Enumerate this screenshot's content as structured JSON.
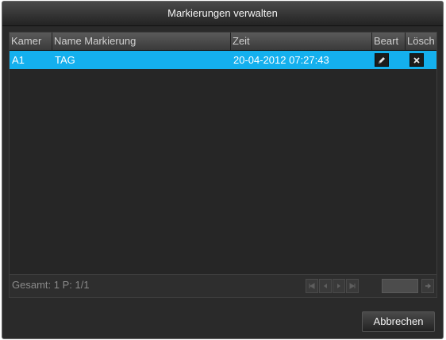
{
  "dialog": {
    "title": "Markierungen verwalten"
  },
  "table": {
    "columns": [
      "Kamer",
      "Name Markierung",
      "Zeit",
      "Beart",
      "Lösch"
    ],
    "rows": [
      {
        "camera": "A1",
        "name": "TAG",
        "time": "20-04-2012 07:27:43"
      }
    ]
  },
  "footer": {
    "summary": "Gesamt: 1 P: 1/1"
  },
  "buttons": {
    "cancel_label": "Abbrechen"
  },
  "colors": {
    "selected_row": "#14b0ee",
    "background": "#2a2a2a"
  },
  "icons": {
    "edit": "pencil-icon",
    "delete": "close-icon",
    "pager": [
      "first-page-icon",
      "prev-page-icon",
      "next-page-icon",
      "last-page-icon",
      "go-arrow-icon"
    ]
  }
}
